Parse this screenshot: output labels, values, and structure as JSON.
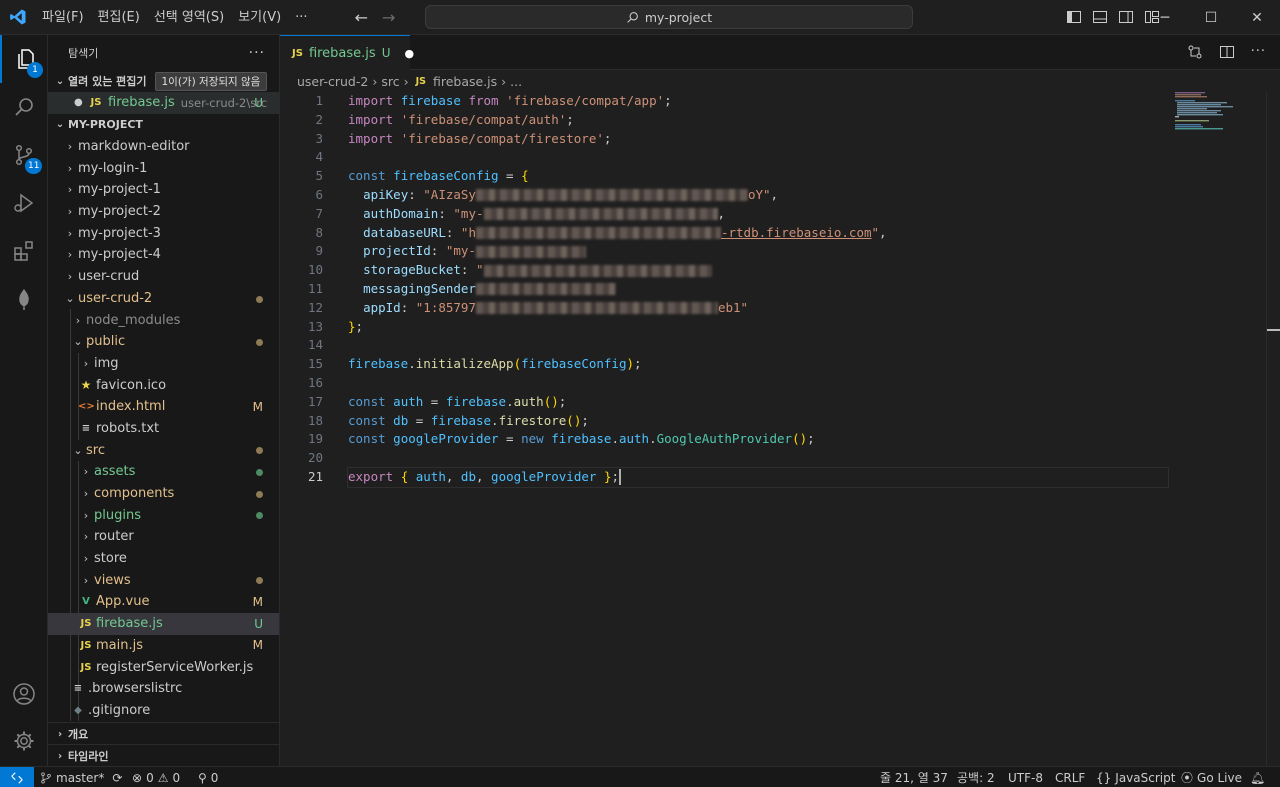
{
  "titlebar": {
    "menu": [
      "파일(F)",
      "편집(E)",
      "선택 영역(S)",
      "보기(V)",
      "···"
    ],
    "search": "my-project"
  },
  "activitybar": {
    "explorer_badge": "1",
    "scm_badge": "11"
  },
  "sidebar": {
    "title": "탐색기",
    "open_editors": {
      "label": "열려 있는 편집기",
      "unsaved": "1이(가) 저장되지 않음",
      "file": {
        "name": "firebase.js",
        "path": "user-crud-2\\src",
        "status": "U"
      }
    },
    "project": "MY-PROJECT",
    "tree": [
      {
        "label": "markdown-editor",
        "type": "folder"
      },
      {
        "label": "my-login-1",
        "type": "folder"
      },
      {
        "label": "my-project-1",
        "type": "folder"
      },
      {
        "label": "my-project-2",
        "type": "folder"
      },
      {
        "label": "my-project-3",
        "type": "folder"
      },
      {
        "label": "my-project-4",
        "type": "folder"
      },
      {
        "label": "user-crud",
        "type": "folder"
      },
      {
        "label": "user-crud-2",
        "type": "folder-open"
      },
      {
        "label": "node_modules",
        "type": "folder"
      },
      {
        "label": "public",
        "type": "folder-open"
      },
      {
        "label": "img",
        "type": "folder"
      },
      {
        "label": "favicon.ico",
        "type": "file"
      },
      {
        "label": "index.html",
        "type": "file",
        "status": "M"
      },
      {
        "label": "robots.txt",
        "type": "file"
      },
      {
        "label": "src",
        "type": "folder-open"
      },
      {
        "label": "assets",
        "type": "folder"
      },
      {
        "label": "components",
        "type": "folder"
      },
      {
        "label": "plugins",
        "type": "folder"
      },
      {
        "label": "router",
        "type": "folder"
      },
      {
        "label": "store",
        "type": "folder"
      },
      {
        "label": "views",
        "type": "folder"
      },
      {
        "label": "App.vue",
        "type": "file",
        "status": "M"
      },
      {
        "label": "firebase.js",
        "type": "file",
        "status": "U"
      },
      {
        "label": "main.js",
        "type": "file",
        "status": "M"
      },
      {
        "label": "registerServiceWorker.js",
        "type": "file"
      },
      {
        "label": ".browserslistrc",
        "type": "file"
      },
      {
        "label": ".gitignore",
        "type": "file"
      }
    ],
    "outline": "개요",
    "timeline": "타임라인"
  },
  "editor": {
    "tab": {
      "name": "firebase.js",
      "status": "U"
    },
    "breadcrumb": [
      "user-crud-2",
      "src",
      "firebase.js",
      "..."
    ],
    "file_icon_label": "JS",
    "line_numbers": [
      "1",
      "2",
      "3",
      "4",
      "5",
      "6",
      "7",
      "8",
      "9",
      "10",
      "11",
      "12",
      "13",
      "14",
      "15",
      "16",
      "17",
      "18",
      "19",
      "20",
      "21"
    ],
    "code": {
      "l1_kw": "import",
      "l1_id": "firebase",
      "l1_from": "from",
      "l1_str": "'firebase/compat/app'",
      "l2_kw": "import",
      "l2_str": "'firebase/compat/auth'",
      "l3_kw": "import",
      "l3_str": "'firebase/compat/firestore'",
      "l5_kw": "const",
      "l5_id": "firebaseConfig",
      "l6_key": "apiKey",
      "l6_a": "\"AIzaSy",
      "l6_b": "oY\"",
      "l7_key": "authDomain",
      "l7_a": "\"my-",
      "l8_key": "databaseURL",
      "l8_a": "\"h",
      "l8_b": "-rtdb.firebaseio.com",
      "l8_c": "\"",
      "l9_key": "projectId",
      "l9_a": "\"my-",
      "l10_key": "storageBucket",
      "l10_a": "\"",
      "l11_key": "messagingSender",
      "l12_key": "appId",
      "l12_a": "\"1:85797",
      "l12_b": "eb1\"",
      "l15_obj": "firebase",
      "l15_fn": "initializeApp",
      "l15_arg": "firebaseConfig",
      "l17_kw": "const",
      "l17_id": "auth",
      "l17_obj": "firebase",
      "l17_fn": "auth",
      "l18_kw": "const",
      "l18_id": "db",
      "l18_obj": "firebase",
      "l18_fn": "firestore",
      "l19_kw": "const",
      "l19_id": "googleProvider",
      "l19_new": "new",
      "l19_obj": "firebase",
      "l19_prop": "auth",
      "l19_cls": "GoogleAuthProvider",
      "l21_kw": "export",
      "l21_a": "auth",
      "l21_b": "db",
      "l21_c": "googleProvider"
    }
  },
  "statusbar": {
    "branch": "master*",
    "errors": "0",
    "warnings": "0",
    "ports": "0",
    "position": "줄 21, 열 37",
    "indent": "공백: 2",
    "encoding": "UTF-8",
    "eol": "CRLF",
    "language": "JavaScript",
    "golive": "Go Live"
  },
  "colors": {
    "accent": "#0078d4",
    "modified": "#e2c08d",
    "untracked": "#73c991",
    "js": "#e8d44d"
  }
}
